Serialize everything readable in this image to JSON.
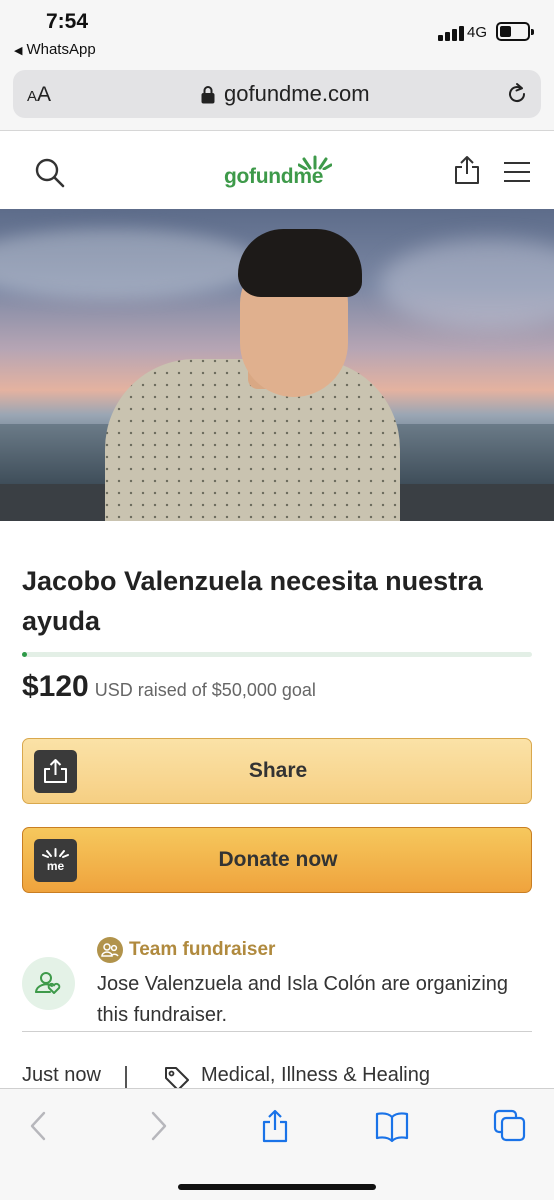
{
  "status_bar": {
    "time": "7:54",
    "back_app": "WhatsApp",
    "network": "4G"
  },
  "browser": {
    "text_size_label_small": "A",
    "text_size_label_large": "A",
    "url": "gofundme.com"
  },
  "site": {
    "logo_text": "gofundme",
    "brand_color": "#3e9a4a"
  },
  "campaign": {
    "title": "Jacobo Valenzuela necesita nuestra ayuda",
    "raised_amount": "$120",
    "raised_text": "USD raised of $50,000 goal",
    "progress_fraction": 0.0024,
    "share_label": "Share",
    "donate_label": "Donate now",
    "team_label": "Team fundraiser",
    "organizers_text": "Jose Valenzuela and Isla Colón are organizing this fundraiser.",
    "created": "Just now",
    "category": "Medical, Illness & Healing"
  },
  "icons": [
    "search-icon",
    "share-icon",
    "menu-icon",
    "lock-icon",
    "reload-icon",
    "back-icon",
    "forward-icon",
    "bookmarks-icon",
    "tabs-icon",
    "tag-icon",
    "team-icon",
    "organizer-icon",
    "gofundme-me-icon"
  ]
}
